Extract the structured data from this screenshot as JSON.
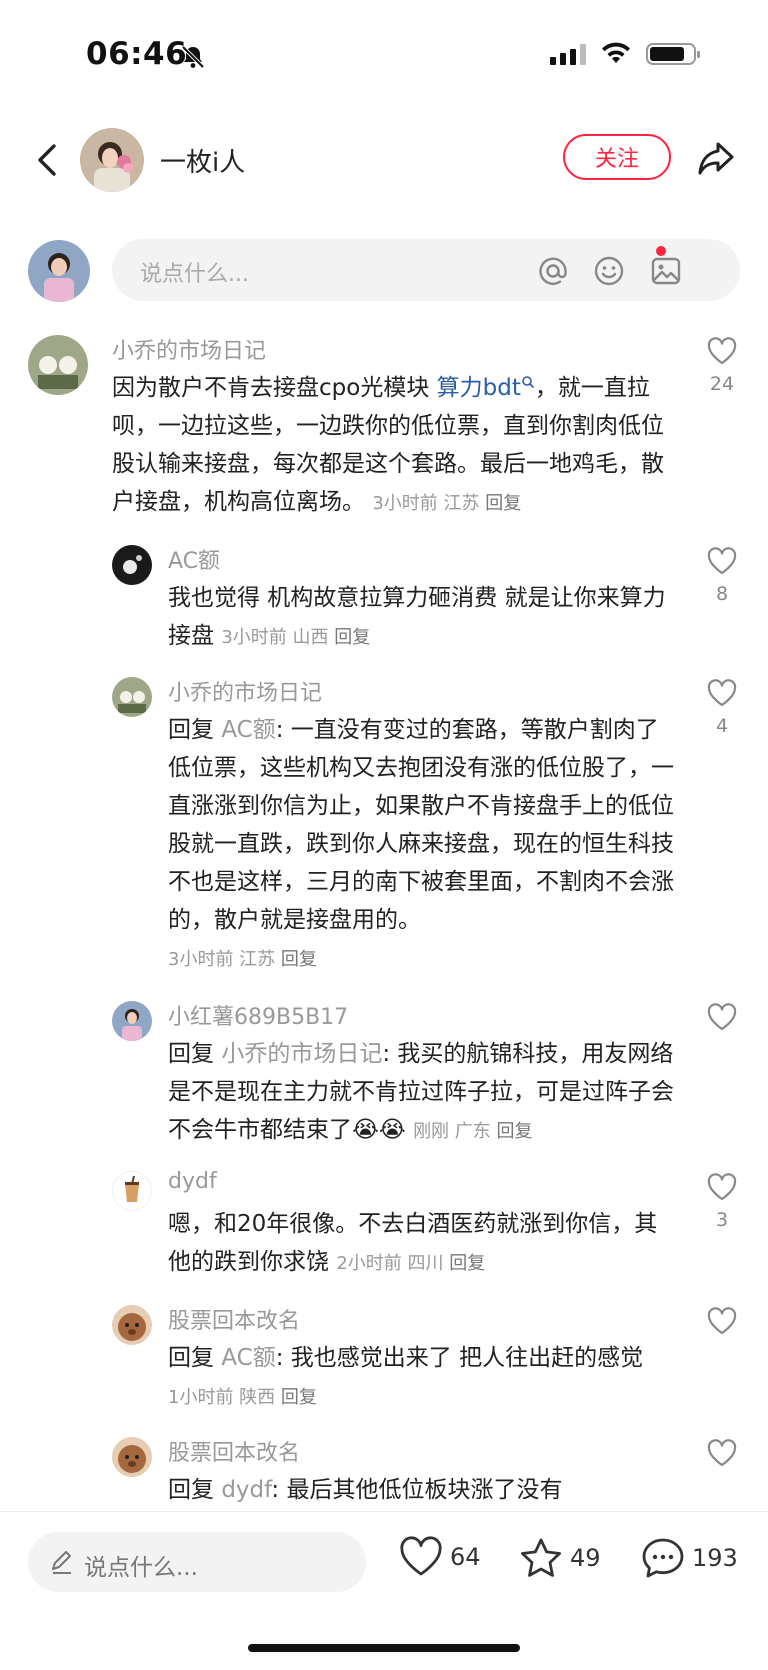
{
  "status_bar": {
    "time": "06:46"
  },
  "header": {
    "author_name": "一枚ⅰ人",
    "follow_label": "关注"
  },
  "compose": {
    "placeholder": "说点什么..."
  },
  "comments": [
    {
      "name": "小乔的市场日记",
      "text_before": "因为散户不肯去接盘cpo光模块 ",
      "highlight": "算力bdt",
      "text_after": "，就一直拉呗，一边拉这些，一边跌你的低位票，直到你割肉低位股认输来接盘，每次都是这个套路。最后一地鸡毛，散户接盘，机构高位离场。",
      "meta": "3小时前 江苏",
      "reply": "回复",
      "likes": "24"
    },
    {
      "name": "AC额",
      "text": "我也觉得 机构故意拉算力砸消费 就是让你来算力接盘",
      "meta": "3小时前 山西",
      "reply": "回复",
      "likes": "8"
    },
    {
      "name": "小乔的市场日记",
      "reply_prefix": "回复",
      "mention": "AC额",
      "text": ": 一直没有变过的套路，等散户割肉了低位票，这些机构又去抱团没有涨的低位股了，一直涨涨到你信为止，如果散户不肯接盘手上的低位股就一直跌，跌到你人麻来接盘，现在的恒生科技不也是这样，三月的南下被套里面，不割肉不会涨的，散户就是接盘用的。",
      "meta": "3小时前 江苏",
      "reply": "回复",
      "likes": "4"
    },
    {
      "name": "小红薯689B5B17",
      "reply_prefix": "回复",
      "mention": "小乔的市场日记",
      "text": ": 我买的航锦科技，用友网络是不是现在主力就不肯拉过阵子拉，可是过阵子会不会牛市都结束了",
      "emoji": "😭😭",
      "meta": "刚刚 广东",
      "reply": "回复",
      "likes": ""
    },
    {
      "name": "dydf",
      "text": "嗯，和20年很像。不去白酒医药就涨到你信，其他的跌到你求饶",
      "meta": "2小时前 四川",
      "reply": "回复",
      "likes": "3"
    },
    {
      "name": "股票回本改名",
      "reply_prefix": "回复",
      "mention": "AC额",
      "text": ": 我也感觉出来了 把人往出赶的感觉",
      "meta": "1小时前 陕西",
      "reply": "回复",
      "likes": ""
    },
    {
      "name": "股票回本改名",
      "reply_prefix": "回复",
      "mention": "dydf",
      "text": ": 最后其他低位板块涨了没有",
      "likes": ""
    }
  ],
  "bottom_bar": {
    "placeholder": "说点什么...",
    "likes": "64",
    "favorites": "49",
    "comments": "193"
  },
  "colors": {
    "accent": "#ff2442",
    "link": "#2a5ea8",
    "muted": "#999999"
  },
  "icons": [
    "bell-off-icon",
    "signal-icon",
    "wifi-icon",
    "battery-icon",
    "back-icon",
    "share-icon",
    "at-icon",
    "emoji-icon",
    "image-icon",
    "heart-icon",
    "star-icon",
    "comment-icon",
    "pencil-icon"
  ]
}
